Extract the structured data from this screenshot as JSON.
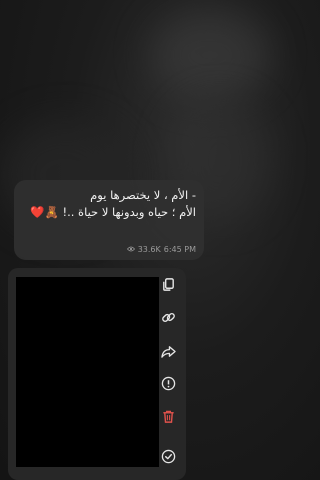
{
  "message": {
    "line1": "- الأم ، لا يختصرها يوم",
    "line2": "الأم ؛ حياه وبدونها لا حياة ..! 🧸❤️",
    "views": "33.6K",
    "time": "6:45 PM"
  },
  "actions": [
    "copy-icon",
    "link-icon",
    "forward-icon",
    "info-icon",
    "delete-icon",
    "select-icon"
  ],
  "colors": {
    "delete": "#e0524c",
    "icon": "#e6e6e6"
  }
}
